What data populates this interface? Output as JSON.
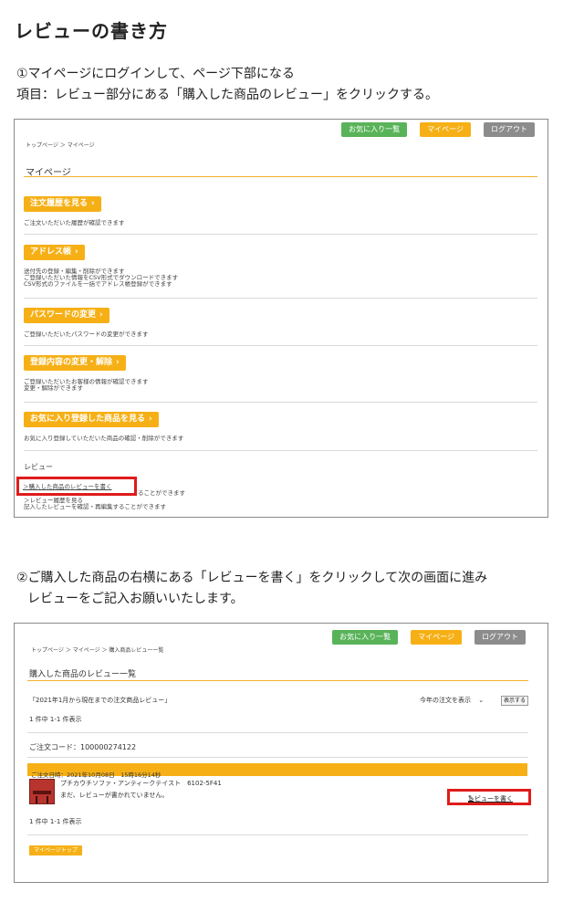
{
  "title": "レビューの書き方",
  "step1": {
    "line1": "①マイページにログインして、ページ下部になる",
    "line2": "項目：レビュー部分にある「購入した商品のレビュー」をクリックする。"
  },
  "step2": {
    "line1": "②ご購入した商品の右横にある「レビューを書く」をクリックして次の画面に進み",
    "line2": "レビューをご記入お願いいたします。"
  },
  "header_buttons": {
    "favorites": "お気に入り一覧",
    "mypage": "マイページ",
    "logout": "ログアウト"
  },
  "colors": {
    "accent": "#f6b016",
    "green": "#59b359",
    "gray": "#8c8c8c",
    "highlight": "#e01b1b"
  },
  "shot1": {
    "breadcrumb": "トップページ ＞ マイページ",
    "heading": "マイページ",
    "sections": [
      {
        "button": "注文履歴を見る",
        "desc": [
          "ご注文いただいた履歴が確認できます"
        ]
      },
      {
        "button": "アドレス帳",
        "desc": [
          "送付先の登録・編集・削除ができます",
          "ご登録いただいた情報をCSV形式でダウンロードできます",
          "CSV形式のファイルを一括でアドレス帳登録ができます"
        ]
      },
      {
        "button": "パスワードの変更",
        "desc": [
          "ご登録いただいたパスワードの変更ができます"
        ]
      },
      {
        "button": "登録内容の変更・解除",
        "desc": [
          "ご登録いただいたお客様の情報が確認できます",
          "変更・解除ができます"
        ]
      },
      {
        "button": "お気に入り登録した商品を見る",
        "desc": [
          "お気に入り登録していただいた商品の確認・削除ができます"
        ]
      }
    ],
    "review": {
      "label": "レビュー",
      "link1": "＞購入した商品のレビューを書く",
      "link1_desc": "ることができます",
      "link2": "＞レビュー履歴を見る",
      "link2_desc": "記入したレビューを確認・再編集することができます"
    }
  },
  "shot2": {
    "breadcrumb": "トップページ ＞ マイページ ＞ 購入商品レビュー一覧",
    "heading": "購入した商品のレビュー一覧",
    "period": "「2021年1月から現在までの注文商品レビュー」",
    "select": "今年の注文を表示",
    "show_button": "表示する",
    "count_top": "1 件中 1-1 件表示",
    "order_code": "ご注文コード：100000274122",
    "order_date": "ご注文日時：2021年10月08日　15時16分14秒",
    "product_name": "プチカウチソファ・アンティークテイスト　6102-5F41",
    "not_reviewed": "まだ、レビューが書かれていません。",
    "write_review": "レビューを書く",
    "count_bottom": "1 件中 1-1 件表示",
    "mypage_top": "マイページトップ"
  }
}
